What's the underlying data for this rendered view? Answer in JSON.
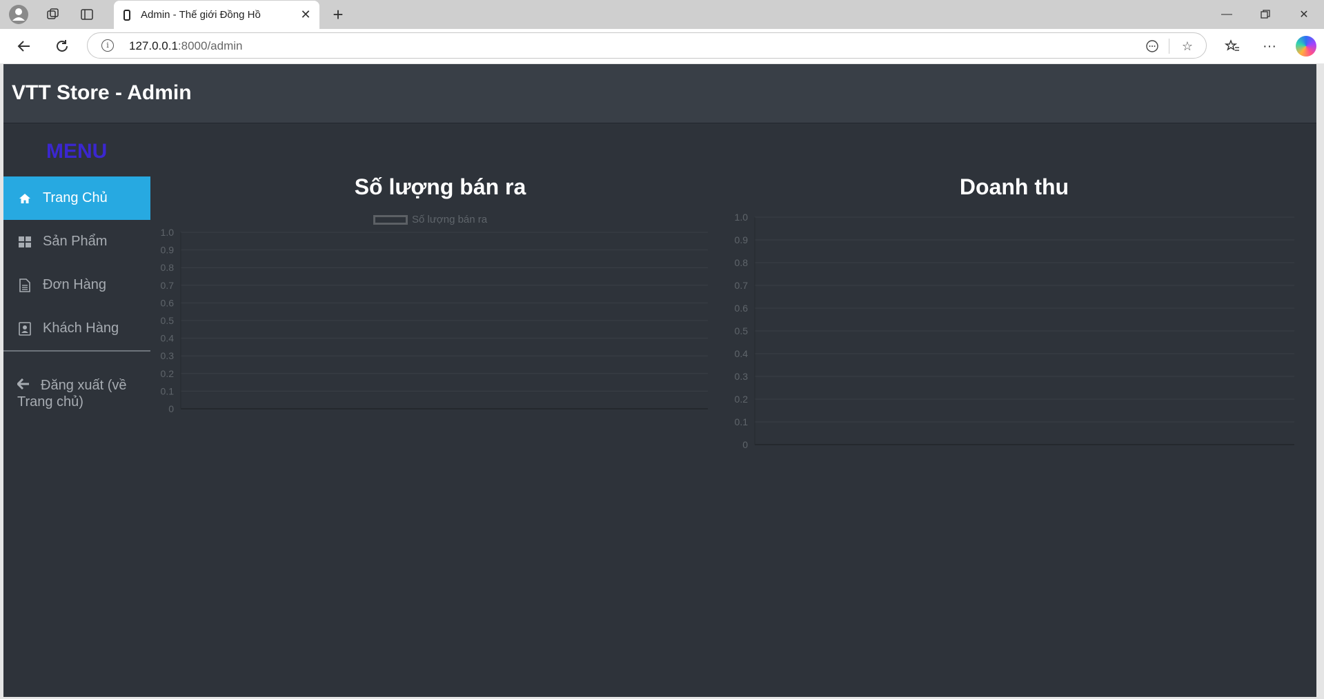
{
  "browser": {
    "tab_title": "Admin - Thế giới Đồng Hồ",
    "url_host": "127.0.0.1",
    "url_rest": ":8000/admin"
  },
  "app": {
    "brand": "VTT Store - Admin",
    "menu_title": "MENU"
  },
  "sidebar": {
    "items": [
      {
        "label": "Trang Chủ",
        "icon": "home-icon",
        "active": true
      },
      {
        "label": "Sản Phẩm",
        "icon": "grid-icon",
        "active": false
      },
      {
        "label": "Đơn Hàng",
        "icon": "file-icon",
        "active": false
      },
      {
        "label": "Khách Hàng",
        "icon": "contact-icon",
        "active": false
      }
    ],
    "logout_label": "Đăng xuất (về Trang chủ)"
  },
  "colors": {
    "page_bg": "#2e333a",
    "header_bg": "#393f47",
    "accent": "#27a9e1",
    "menu_title": "#3b27cf",
    "grid": "#3a3f46",
    "tick": "#5f656b"
  },
  "chart_data": [
    {
      "type": "bar",
      "title": "Số lượng bán ra",
      "categories": [],
      "series": [
        {
          "name": "Số lượng bán ra",
          "values": []
        }
      ],
      "ylim": [
        0,
        1
      ],
      "yticks": [
        "0",
        "0.1",
        "0.2",
        "0.3",
        "0.4",
        "0.5",
        "0.6",
        "0.7",
        "0.8",
        "0.9",
        "1.0"
      ],
      "grid": true,
      "legend": "top"
    },
    {
      "type": "line",
      "title": "Doanh thu",
      "categories": [],
      "series": [
        {
          "values": []
        }
      ],
      "ylim": [
        0,
        1
      ],
      "yticks": [
        "0",
        "0.1",
        "0.2",
        "0.3",
        "0.4",
        "0.5",
        "0.6",
        "0.7",
        "0.8",
        "0.9",
        "1.0"
      ],
      "grid": true,
      "legend": "none"
    }
  ]
}
